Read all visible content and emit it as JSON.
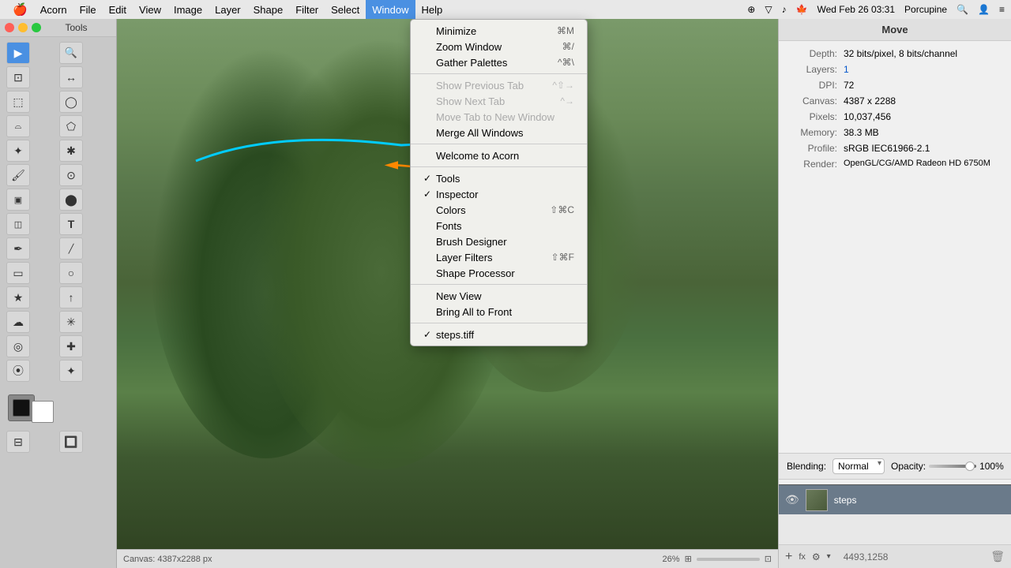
{
  "menubar": {
    "apple": "🍎",
    "items": [
      "Acorn",
      "File",
      "Edit",
      "View",
      "Image",
      "Layer",
      "Shape",
      "Filter",
      "Select",
      "Window",
      "Help"
    ],
    "active_item": "Window",
    "right": {
      "time": "Wed Feb 26  03:31",
      "user": "Porcupine"
    }
  },
  "toolbar": {
    "title": "Tools",
    "traffic": [
      "red",
      "yellow",
      "green"
    ]
  },
  "window_menu": {
    "items": [
      {
        "label": "Minimize",
        "shortcut": "⌘M",
        "disabled": false,
        "check": ""
      },
      {
        "label": "Zoom Window",
        "shortcut": "⌘/",
        "disabled": false,
        "check": ""
      },
      {
        "label": "Gather Palettes",
        "shortcut": "^⌘\\",
        "disabled": false,
        "check": ""
      },
      {
        "separator": true
      },
      {
        "label": "Show Previous Tab",
        "shortcut": "^⇧→",
        "disabled": true,
        "check": ""
      },
      {
        "label": "Show Next Tab",
        "shortcut": "^→",
        "disabled": true,
        "check": ""
      },
      {
        "label": "Move Tab to New Window",
        "shortcut": "",
        "disabled": true,
        "check": ""
      },
      {
        "label": "Merge All Windows",
        "shortcut": "",
        "disabled": false,
        "check": ""
      },
      {
        "separator": true
      },
      {
        "label": "Welcome to Acorn",
        "shortcut": "",
        "disabled": false,
        "check": ""
      },
      {
        "separator": true
      },
      {
        "label": "Tools",
        "shortcut": "",
        "disabled": false,
        "check": "✓"
      },
      {
        "label": "Inspector",
        "shortcut": "",
        "disabled": false,
        "check": "✓"
      },
      {
        "label": "Colors",
        "shortcut": "⇧⌘C",
        "disabled": false,
        "check": ""
      },
      {
        "label": "Fonts",
        "shortcut": "",
        "disabled": false,
        "check": ""
      },
      {
        "label": "Brush Designer",
        "shortcut": "",
        "disabled": false,
        "check": ""
      },
      {
        "label": "Layer Filters",
        "shortcut": "⇧⌘F",
        "disabled": false,
        "check": ""
      },
      {
        "label": "Shape Processor",
        "shortcut": "",
        "disabled": false,
        "check": ""
      },
      {
        "separator": true
      },
      {
        "label": "New View",
        "shortcut": "",
        "disabled": false,
        "check": ""
      },
      {
        "label": "Bring All to Front",
        "shortcut": "",
        "disabled": false,
        "check": ""
      },
      {
        "separator": true
      },
      {
        "label": "steps.tiff",
        "shortcut": "",
        "disabled": false,
        "check": "✓"
      }
    ]
  },
  "inspector": {
    "title": "Move",
    "rows": [
      {
        "label": "Depth:",
        "value": "32 bits/pixel, 8 bits/channel",
        "blue": false
      },
      {
        "label": "Layers:",
        "value": "1",
        "blue": true
      },
      {
        "label": "DPI:",
        "value": "72",
        "blue": false
      },
      {
        "label": "Canvas:",
        "value": "4387 x 2288",
        "blue": false
      },
      {
        "label": "Pixels:",
        "value": "10,037,456",
        "blue": false
      },
      {
        "label": "Memory:",
        "value": "38.3 MB",
        "blue": false
      },
      {
        "label": "Profile:",
        "value": "sRGB IEC61966-2.1",
        "blue": false
      },
      {
        "label": "Render:",
        "value": "OpenGL/CG/AMD Radeon HD 6750M",
        "blue": false
      }
    ],
    "blending": {
      "label": "Blending:",
      "mode": "Normal",
      "opacity_label": "Opacity:",
      "opacity_value": "100%"
    },
    "layer": {
      "name": "steps",
      "visible": true
    },
    "bottom": {
      "coords": "4493,1258"
    }
  },
  "statusbar": {
    "canvas_info": "Canvas: 4387x2288 px",
    "zoom": "26%"
  },
  "icons": {
    "arrow_tool": "▶",
    "zoom_tool": "⌖",
    "crop_tool": "⊡",
    "transform_tool": "↔",
    "rect_select": "⬚",
    "ellipse_select": "◯",
    "lasso": "✂",
    "polygon": "⬠",
    "magic_wand": "/",
    "color_wand": "✦",
    "paint": "⬤",
    "gradient": "▣",
    "text": "T",
    "vector": "◈",
    "line": "/",
    "rect_shape": "▭",
    "ellipse_shape": "◯",
    "star_shape": "★",
    "arrow_shape": "↑",
    "clone": "◎",
    "heal": "✚",
    "burn": "◗",
    "dodge": "◑",
    "blur": "☁",
    "color_swatch_fg": "#000000",
    "color_swatch_bg": "#ffffff",
    "eye_icon": "👁"
  }
}
